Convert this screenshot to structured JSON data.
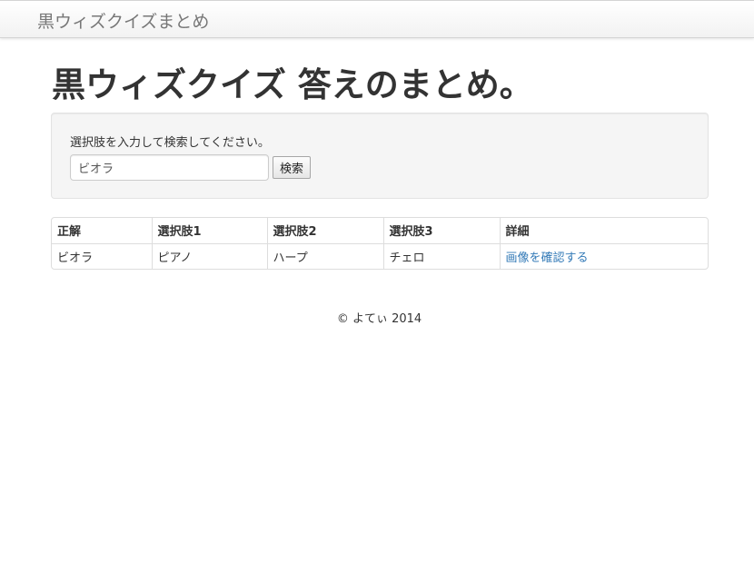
{
  "navbar": {
    "brand": "黒ウィズクイズまとめ"
  },
  "page_title": "黒ウィズクイズ 答えのまとめ。",
  "search": {
    "hint": "選択肢を入力して検索してください。",
    "value": "ビオラ",
    "button_label": "検索"
  },
  "table": {
    "headers": [
      "正解",
      "選択肢1",
      "選択肢2",
      "選択肢3",
      "詳細"
    ],
    "rows": [
      {
        "answer": "ビオラ",
        "choice1": "ピアノ",
        "choice2": "ハープ",
        "choice3": "チェロ",
        "detail_link": "画像を確認する"
      }
    ]
  },
  "footer": {
    "text": "© よてぃ 2014"
  },
  "colors": {
    "link": "#337ab7",
    "well_background": "#f5f5f5"
  }
}
